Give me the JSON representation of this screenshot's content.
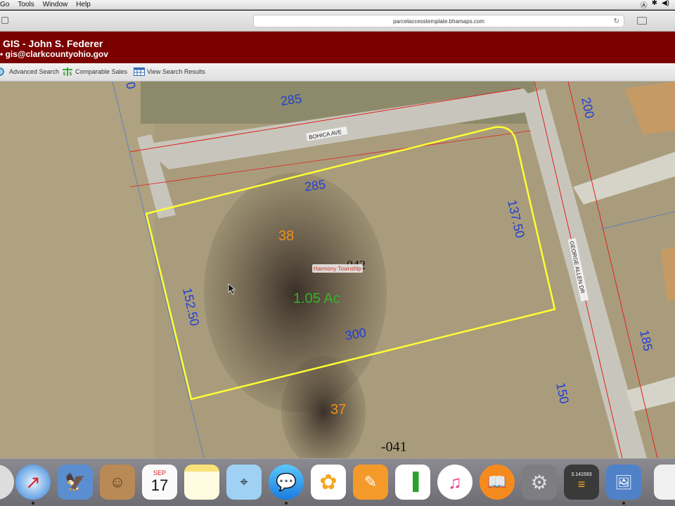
{
  "menubar": {
    "items": [
      "Go",
      "Tools",
      "Window",
      "Help"
    ],
    "status": [
      "Ⓐ",
      "✱",
      "◀)"
    ]
  },
  "browser": {
    "url": "parcelaccesstemplate.bhamaps.com"
  },
  "site": {
    "title": "GIS - John S. Federer",
    "email": "gis@clarkcountyohio.gov"
  },
  "toolbar": {
    "advanced_search": "Advanced Search",
    "comparable_sales": "Comparable Sales",
    "view_results": "View Search Results"
  },
  "map": {
    "street_top": "BOHICA AVE",
    "street_right": "GEORGE ALLEN DR",
    "township": "Harmony Township",
    "parcel_id": "-042",
    "parcel_id_below": "-041",
    "acreage": "1.05 Ac",
    "dims": {
      "top_road": "285",
      "top_parcel": "285",
      "right_parcel": "137.50",
      "left_parcel": "152.50",
      "bottom_parcel": "300",
      "top_right_lot": "200",
      "right_lot": "185",
      "bottom_right": "150",
      "left_top": "0"
    },
    "lot_numbers": {
      "upper": "38",
      "lower": "37"
    },
    "colors": {
      "parcel_outline": "#ffff33",
      "dims_text": "#1f3fd6",
      "lot_text": "#f0901a",
      "acreage_text": "#3ab02a",
      "property_lines": "#e02020"
    }
  },
  "dock": {
    "calendar_month": "SEP",
    "calendar_day": "17",
    "calculator_display": "3.141593"
  }
}
